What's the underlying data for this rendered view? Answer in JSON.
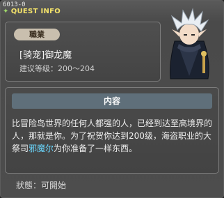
{
  "header": {
    "quest_id": "6013-0",
    "title": "QUEST INFO"
  },
  "job": {
    "tag": "職業",
    "name": "[骑宠]御龙魔",
    "level": "建议等级：200～204"
  },
  "content": {
    "header": "内容",
    "text_part1": "比冒险岛世界的任何人都强的人，已经到达至高境界的人，那就是你。为了祝贺你达到200级，海盗职业的大祭司",
    "npc_name": "邪魔尔",
    "text_part2": "为你准备了一样东西。"
  },
  "status": {
    "label": "狀態：",
    "value": "可開始"
  },
  "colors": {
    "title": "#f4e36a",
    "npc_highlight": "#6ad8ff",
    "tag_bg": "#c9bfae",
    "content_header_bg": "#5f6f7a"
  }
}
